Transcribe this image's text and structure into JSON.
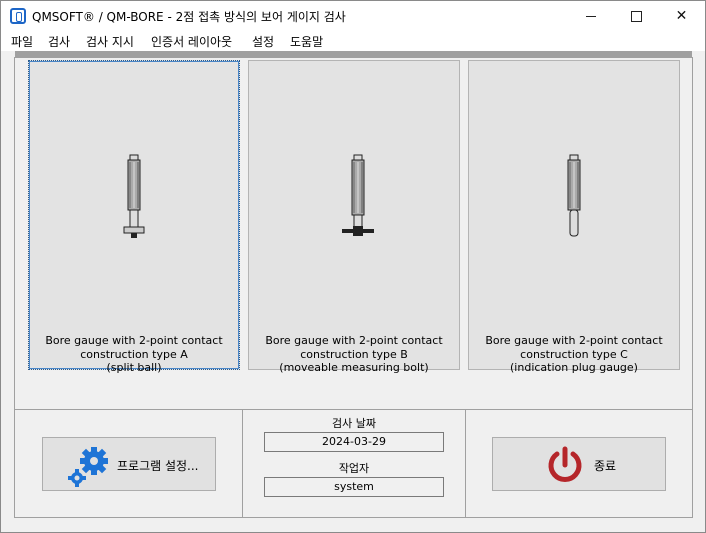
{
  "window": {
    "title": "QMSOFT® / QM-BORE - 2점 접촉 방식의 보어 게이지 검사",
    "controls": {
      "minimize": "—",
      "maximize": "☐",
      "close": "✕"
    }
  },
  "menu": [
    "파일",
    "검사",
    "검사 지시",
    "인증서 레이아웃",
    "설정",
    "도움말"
  ],
  "cards": [
    {
      "line1": "Bore gauge with 2-point contact",
      "line2": "construction type A",
      "line3": "(split ball)",
      "icon": "bore-gauge-split-ball",
      "selected": true
    },
    {
      "line1": "Bore gauge with 2-point contact",
      "line2": "construction type B",
      "line3": "(moveable measuring bolt)",
      "icon": "bore-gauge-measuring-bolt",
      "selected": false
    },
    {
      "line1": "Bore gauge with 2-point contact",
      "line2": "construction type C",
      "line3": "(indication plug gauge)",
      "icon": "bore-gauge-plug",
      "selected": false
    }
  ],
  "bottom": {
    "settings_button": "프로그램 설정...",
    "date_label": "검사 날짜",
    "date_value": "2024-03-29",
    "operator_label": "작업자",
    "operator_value": "system",
    "exit_button": "종료"
  },
  "colors": {
    "gear": "#1e74d6",
    "power": "#b5262a",
    "selection": "#4a86c8"
  }
}
